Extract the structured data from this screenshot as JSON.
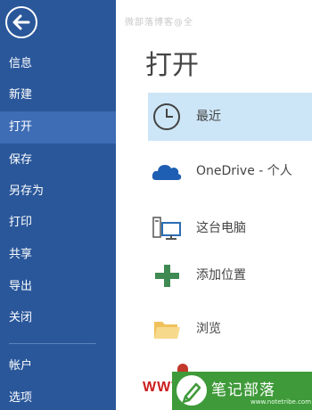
{
  "nav": {
    "items": [
      {
        "label": "信息"
      },
      {
        "label": "新建"
      },
      {
        "label": "打开",
        "active": true
      },
      {
        "label": "保存"
      },
      {
        "label": "另存为"
      },
      {
        "label": "打印"
      },
      {
        "label": "共享"
      },
      {
        "label": "导出"
      },
      {
        "label": "关闭"
      },
      {
        "label": "帐户"
      },
      {
        "label": "选项"
      }
    ]
  },
  "watermark": "微部落博客@全",
  "main": {
    "title": "打开",
    "places": [
      {
        "label": "最近",
        "icon": "clock-icon",
        "selected": true
      },
      {
        "label": "OneDrive - 个人",
        "icon": "cloud-icon"
      },
      {
        "label": "这台电脑",
        "icon": "computer-icon"
      },
      {
        "label": "添加位置",
        "icon": "plus-icon"
      },
      {
        "label": "浏览",
        "icon": "folder-icon"
      }
    ]
  },
  "brand": {
    "red_text": "WWW",
    "name": "笔记部落",
    "url": "www.notetribe.com"
  },
  "colors": {
    "nav_bg": "#2a579a",
    "nav_active": "#3e6db5",
    "selected_bg": "#cde6f7",
    "brand_green": "#3f9a3a"
  }
}
